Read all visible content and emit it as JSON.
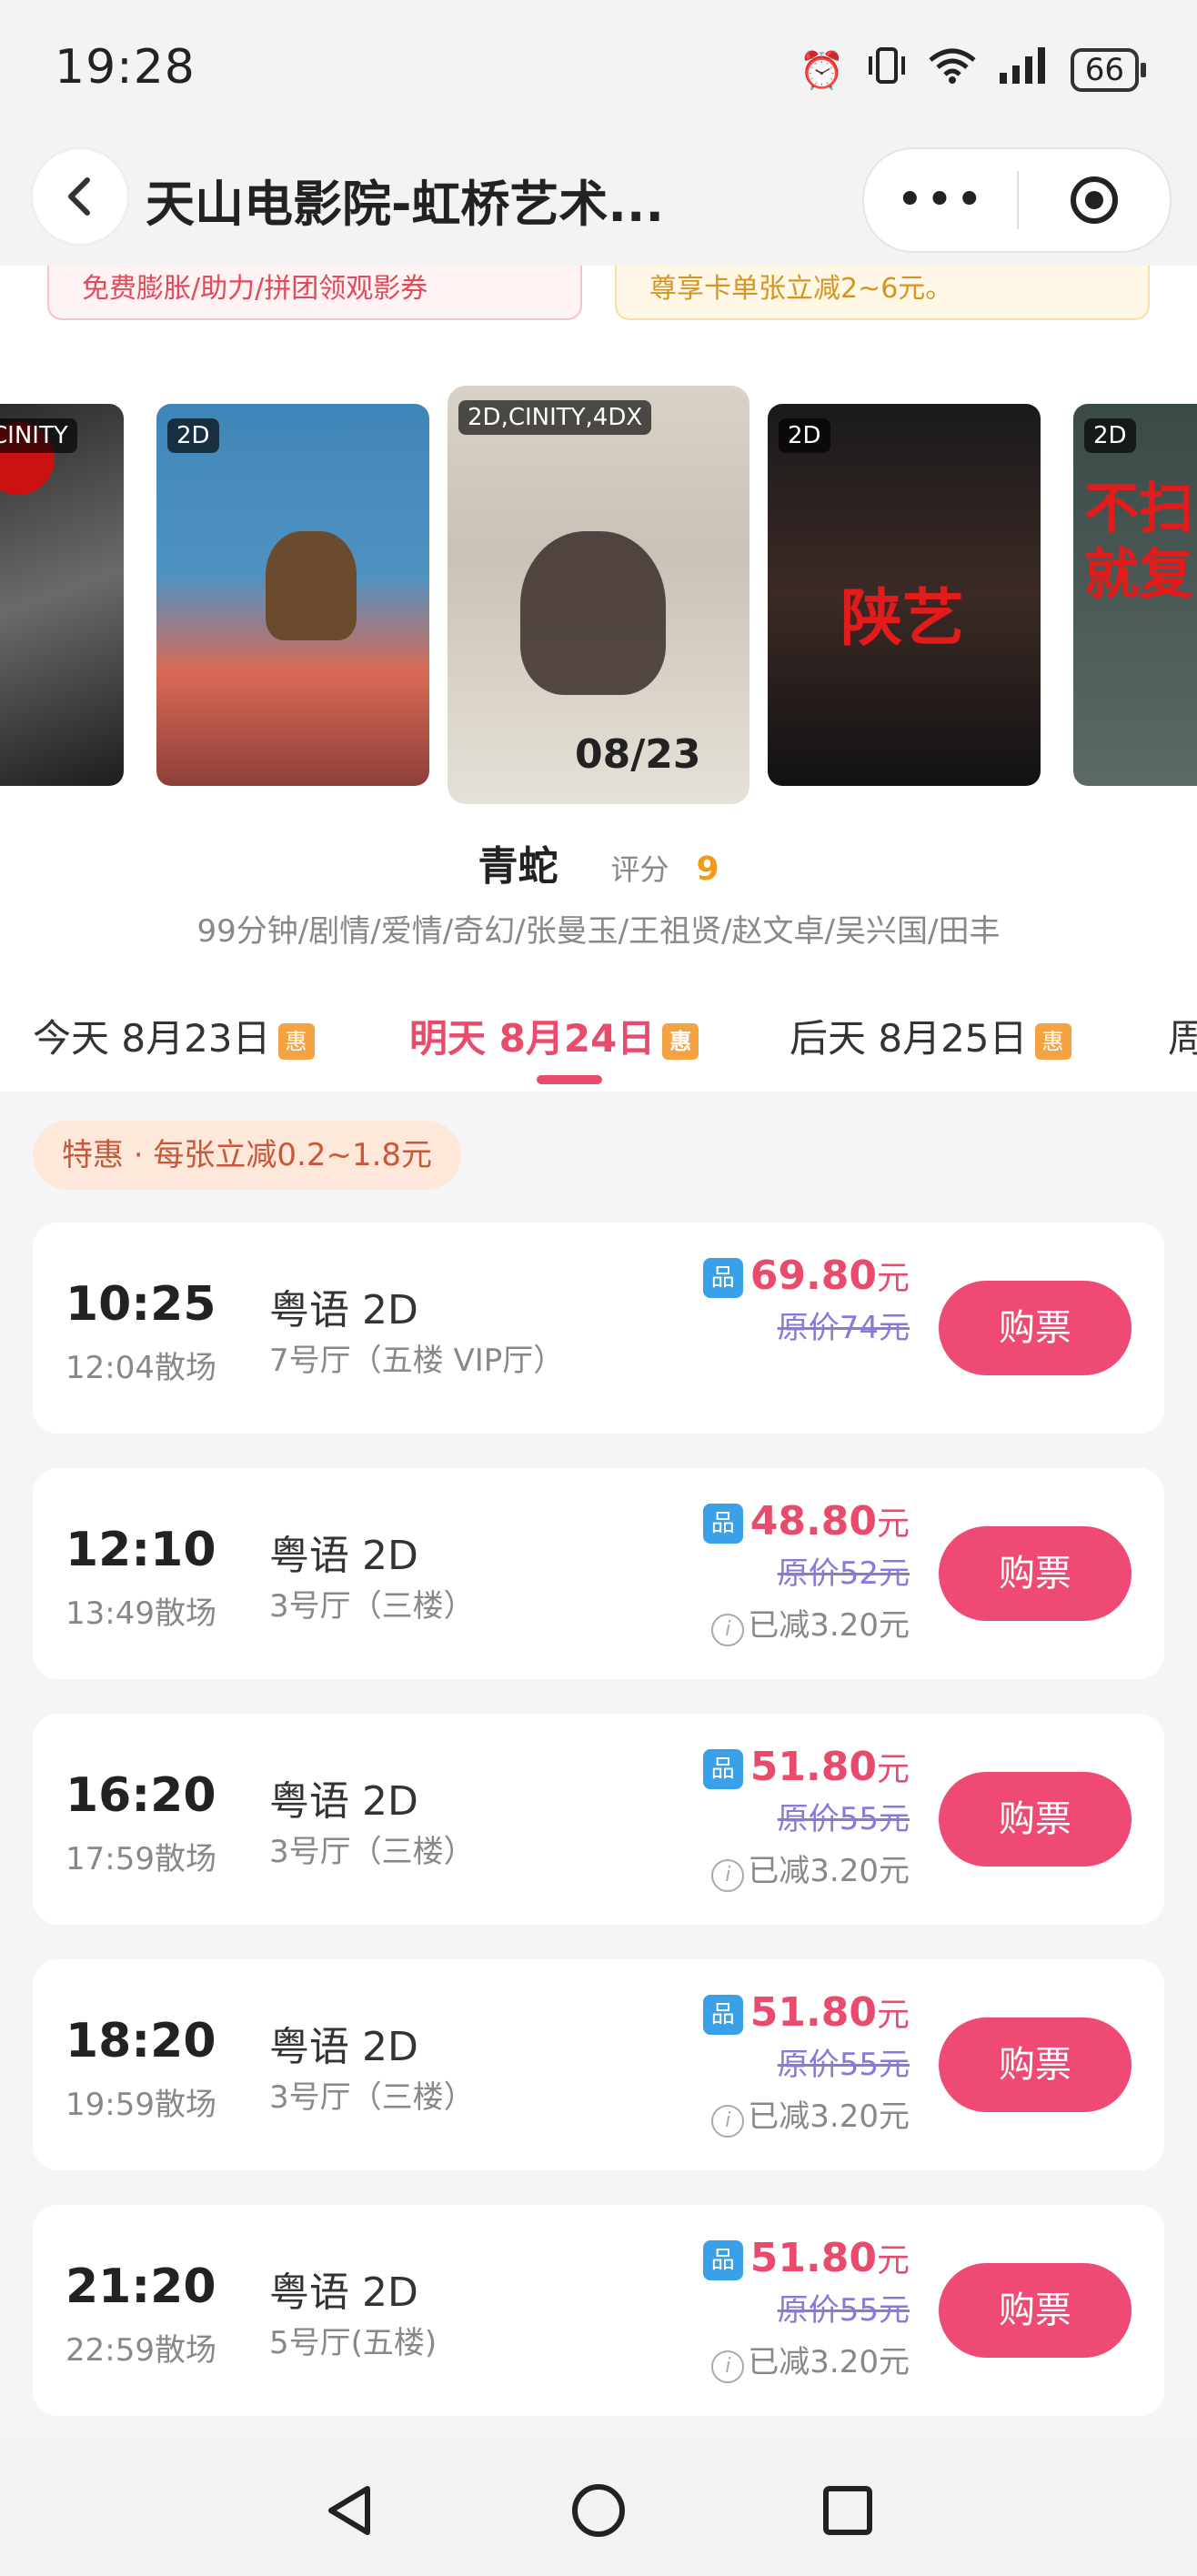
{
  "status_bar": {
    "time": "19:28",
    "battery": "66"
  },
  "nav": {
    "title": "天山电影院-虹桥艺术...",
    "more_label": "•••"
  },
  "promos": {
    "left": "免费膨胀/助力/拼团领观影券",
    "right": "尊享卡单张立减2~6元。"
  },
  "posters": [
    {
      "tag": "CINITY"
    },
    {
      "tag": "2D"
    },
    {
      "tag": "2D,CINITY,4DX",
      "text": "08/23"
    },
    {
      "tag": "2D",
      "text": "陕艺"
    },
    {
      "tag": "2D",
      "text": "不扫就复"
    }
  ],
  "movie": {
    "name": "青蛇",
    "score_label": "评分",
    "score": "9",
    "info": "99分钟/剧情/爱情/奇幻/张曼玉/王祖贤/赵文卓/吴兴国/田丰"
  },
  "dates": [
    {
      "label": "今天 8月23日",
      "badge": "惠"
    },
    {
      "label": "明天 8月24日",
      "badge": "惠"
    },
    {
      "label": "后天 8月25日",
      "badge": "惠"
    },
    {
      "label": "周"
    }
  ],
  "discount_text": "特惠 · 每张立减0.2~1.8元",
  "sessions": [
    {
      "start": "10:25",
      "end": "12:04散场",
      "lang": "粤语 2D",
      "hall": "7号厅（五楼 VIP厅）",
      "price": "69.80",
      "unit": "元",
      "original": "原价74元",
      "reduced": "",
      "buy": "购票"
    },
    {
      "start": "12:10",
      "end": "13:49散场",
      "lang": "粤语 2D",
      "hall": "3号厅（三楼）",
      "price": "48.80",
      "unit": "元",
      "original": "原价52元",
      "reduced": "已减3.20元",
      "buy": "购票"
    },
    {
      "start": "16:20",
      "end": "17:59散场",
      "lang": "粤语 2D",
      "hall": "3号厅（三楼）",
      "price": "51.80",
      "unit": "元",
      "original": "原价55元",
      "reduced": "已减3.20元",
      "buy": "购票"
    },
    {
      "start": "18:20",
      "end": "19:59散场",
      "lang": "粤语 2D",
      "hall": "3号厅（三楼）",
      "price": "51.80",
      "unit": "元",
      "original": "原价55元",
      "reduced": "已减3.20元",
      "buy": "购票"
    },
    {
      "start": "21:20",
      "end": "22:59散场",
      "lang": "粤语 2D",
      "hall": "5号厅(五楼)",
      "price": "51.80",
      "unit": "元",
      "original": "原价55元",
      "reduced": "已减3.20元",
      "buy": "购票"
    }
  ],
  "price_badge": "品",
  "colors": {
    "accent": "#e84b6b",
    "buy_button": "#ee4a74",
    "badge_orange": "#f3a341",
    "badge_blue": "#3aa0e8"
  }
}
